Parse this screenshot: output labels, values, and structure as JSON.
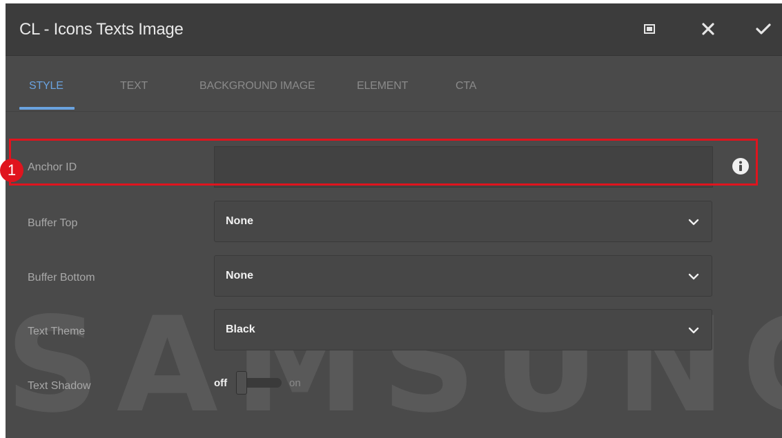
{
  "dialog": {
    "title": "CL - Icons Texts Image",
    "buttons": {
      "fullscreen_icon": "fullscreen-icon",
      "close_icon": "close-icon",
      "confirm_icon": "checkmark-icon"
    }
  },
  "tabs": [
    {
      "label": "STYLE",
      "active": true
    },
    {
      "label": "TEXT",
      "active": false
    },
    {
      "label": "BACKGROUND IMAGE",
      "active": false
    },
    {
      "label": "ELEMENT",
      "active": false
    },
    {
      "label": "CTA",
      "active": false
    }
  ],
  "fields": {
    "anchor_id": {
      "label": "Anchor ID",
      "value": "",
      "info_icon": "info-icon"
    },
    "buffer_top": {
      "label": "Buffer Top",
      "value": "None"
    },
    "buffer_bottom": {
      "label": "Buffer Bottom",
      "value": "None"
    },
    "text_theme": {
      "label": "Text Theme",
      "value": "Black"
    },
    "text_shadow": {
      "label": "Text Shadow",
      "off_label": "off",
      "on_label": "on",
      "state": "off"
    }
  },
  "annotation": {
    "callout_number": "1",
    "color": "#e0141e"
  },
  "watermark": {
    "text": "SAMSUNG"
  },
  "colors": {
    "accent": "#6aa3e0",
    "background": "#4a4a4a",
    "titlebar": "#3c3c3c"
  }
}
